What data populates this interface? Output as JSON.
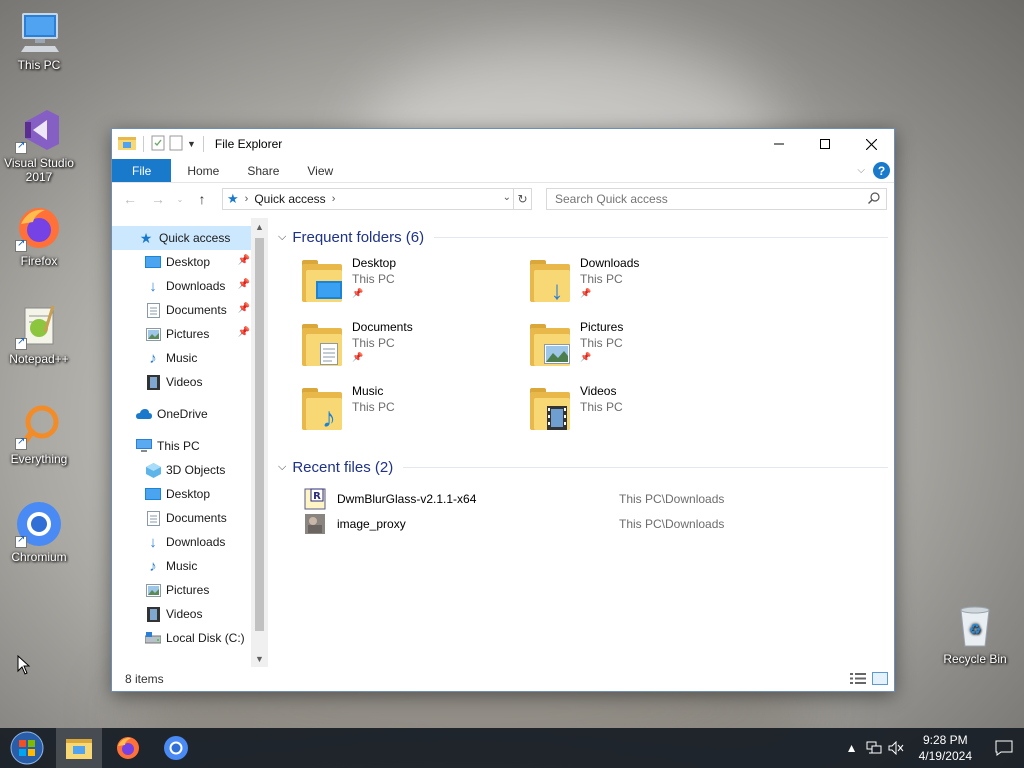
{
  "desktop": {
    "icons": [
      {
        "label": "This PC",
        "icon": "this-pc-icon"
      },
      {
        "label": "Visual Studio 2017",
        "icon": "visual-studio-icon"
      },
      {
        "label": "Firefox",
        "icon": "firefox-icon"
      },
      {
        "label": "Notepad++",
        "icon": "notepadpp-icon"
      },
      {
        "label": "Everything",
        "icon": "everything-icon"
      },
      {
        "label": "Chromium",
        "icon": "chromium-icon"
      },
      {
        "label": "Recycle Bin",
        "icon": "recycle-bin-icon"
      }
    ]
  },
  "window": {
    "title": "File Explorer",
    "ribbon_tabs": {
      "file": "File",
      "home": "Home",
      "share": "Share",
      "view": "View"
    },
    "help": "?",
    "address": {
      "location": "Quick access"
    },
    "search": {
      "placeholder": "Search Quick access"
    },
    "nav": {
      "quick_access": "Quick access",
      "qa_items": [
        "Desktop",
        "Downloads",
        "Documents",
        "Pictures",
        "Music",
        "Videos"
      ],
      "onedrive": "OneDrive",
      "this_pc": "This PC",
      "pc_items": [
        "3D Objects",
        "Desktop",
        "Documents",
        "Downloads",
        "Music",
        "Pictures",
        "Videos",
        "Local Disk (C:)"
      ]
    },
    "frequent": {
      "header": "Frequent folders (6)",
      "folders": [
        {
          "name": "Desktop",
          "location": "This PC",
          "pinned": true
        },
        {
          "name": "Downloads",
          "location": "This PC",
          "pinned": true
        },
        {
          "name": "Documents",
          "location": "This PC",
          "pinned": true
        },
        {
          "name": "Pictures",
          "location": "This PC",
          "pinned": true
        },
        {
          "name": "Music",
          "location": "This PC",
          "pinned": false
        },
        {
          "name": "Videos",
          "location": "This PC",
          "pinned": false
        }
      ]
    },
    "recent": {
      "header": "Recent files (2)",
      "files": [
        {
          "name": "DwmBlurGlass-v2.1.1-x64",
          "path": "This PC\\Downloads"
        },
        {
          "name": "image_proxy",
          "path": "This PC\\Downloads"
        }
      ]
    },
    "status": "8 items"
  },
  "taskbar": {
    "time": "9:28 PM",
    "date": "4/19/2024"
  },
  "colors": {
    "accent": "#1979ca",
    "selection": "#cce8ff",
    "group_header": "#1e3287"
  }
}
